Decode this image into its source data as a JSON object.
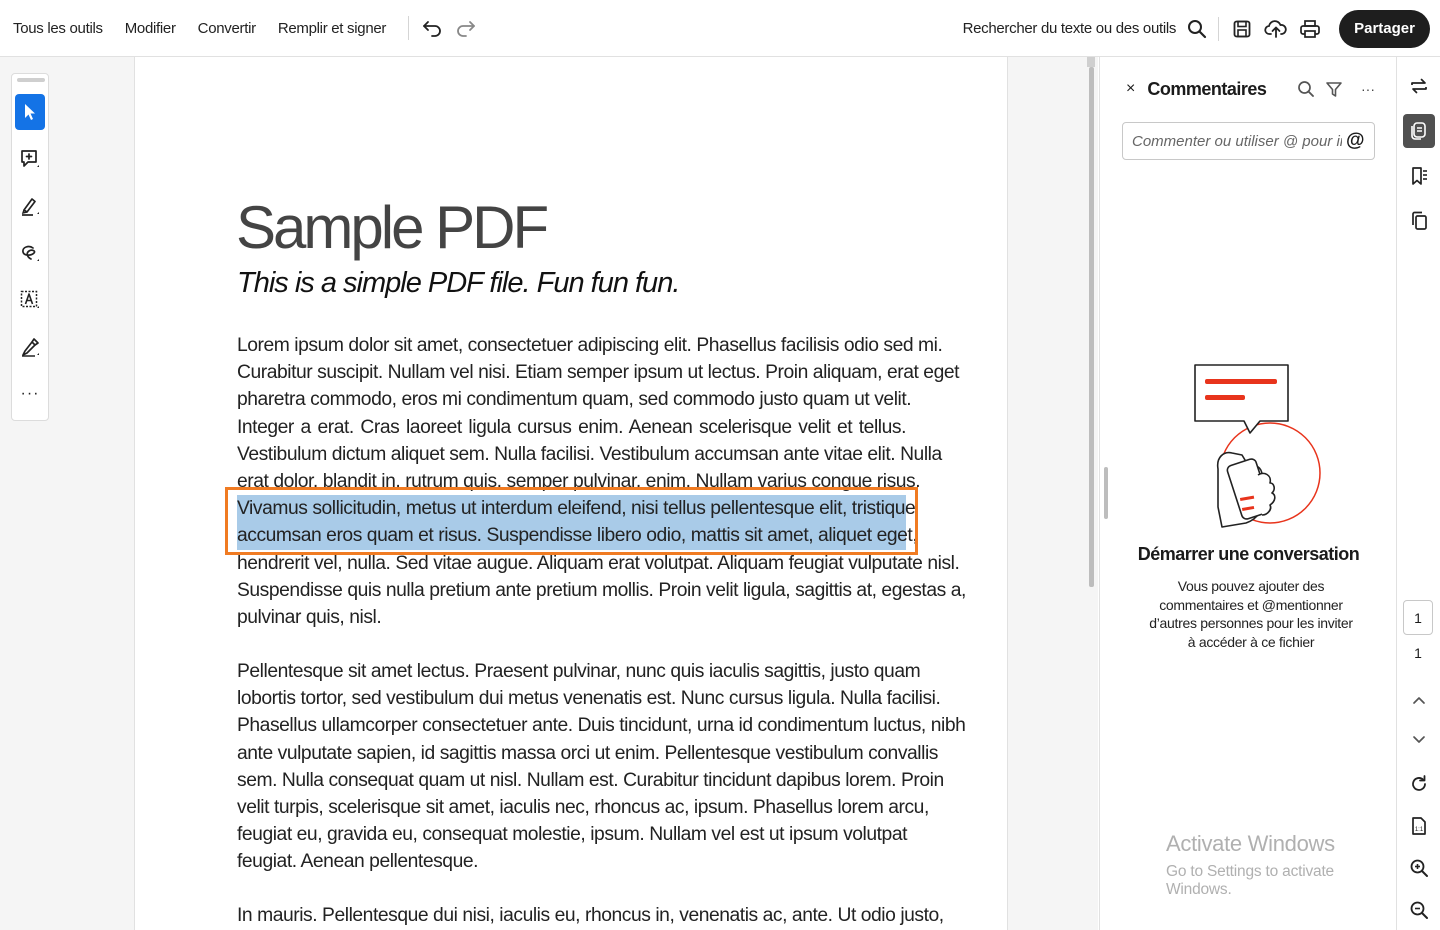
{
  "topbar": {
    "menu": [
      "Tous les outils",
      "Modifier",
      "Convertir",
      "Remplir et signer"
    ],
    "search_label": "Rechercher du texte ou des outils",
    "share_label": "Partager"
  },
  "tools": [
    "select-tool-icon",
    "add-comment-icon",
    "highlight-pen-icon",
    "lasso-draw-icon",
    "text-box-icon",
    "fill-sign-icon",
    "more-icon"
  ],
  "more_label": "···",
  "document": {
    "title": "Sample PDF",
    "subtitle": "This is a simple PDF file. Fun fun fun.",
    "paragraph1": {
      "before": [
        "Lorem ipsum dolor sit amet, consectetuer adipiscing elit. Phasellus facilisis odio sed mi.",
        "Curabitur suscipit. Nullam vel nisi. Etiam semper ipsum ut lectus. Proin aliquam, erat eget",
        "pharetra commodo, eros mi condimentum quam, sed commodo justo quam ut velit.",
        "Integer a erat. Cras laoreet ligula cursus enim. Aenean scelerisque velit et tellus.",
        "Vestibulum dictum aliquet sem. Nulla facilisi. Vestibulum accumsan ante vitae elit. Nulla",
        "erat dolor, blandit in, rutrum quis, semper pulvinar, enim. Nullam varius congue risus."
      ],
      "highlighted": [
        "Vivamus sollicitudin, metus ut interdum eleifend, nisi tellus pellentesque elit, tristique",
        "accumsan eros quam et risus. Suspendisse libero odio, mattis sit amet, aliquet eget,"
      ],
      "after": [
        "hendrerit vel, nulla. Sed vitae augue. Aliquam erat volutpat. Aliquam feugiat vulputate nisl.",
        "Suspendisse quis nulla pretium ante pretium mollis. Proin velit ligula, sagittis at, egestas a,",
        "pulvinar quis, nisl."
      ]
    },
    "paragraph2": [
      "Pellentesque sit amet lectus. Praesent pulvinar, nunc quis iaculis sagittis, justo quam",
      "lobortis tortor, sed vestibulum dui metus venenatis est. Nunc cursus ligula. Nulla facilisi.",
      "Phasellus ullamcorper consectetuer ante. Duis tincidunt, urna id condimentum luctus, nibh",
      "ante vulputate sapien, id sagittis massa orci ut enim. Pellentesque vestibulum convallis",
      "sem. Nulla consequat quam ut nisl. Nullam est. Curabitur tincidunt dapibus lorem. Proin",
      "velit turpis, scelerisque sit amet, iaculis nec, rhoncus ac, ipsum. Phasellus lorem arcu,",
      "feugiat eu, gravida eu, consequat molestie, ipsum. Nullam vel est ut ipsum volutpat",
      "feugiat. Aenean pellentesque."
    ],
    "paragraph3": [
      "In mauris. Pellentesque dui nisi, iaculis eu, rhoncus in, venenatis ac, ante. Ut odio justo,"
    ]
  },
  "comments": {
    "close": "×",
    "title": "Commentaires",
    "input_placeholder": "Commenter ou utiliser @ pour in...",
    "at_symbol": "@",
    "heading": "Démarrer une conversation",
    "description": "Vous pouvez ajouter des commentaires et @mentionner d’autres personnes pour les inviter à accéder à ce fichier",
    "more": "···"
  },
  "watermark": {
    "line1": "Activate Windows",
    "line2": "Go to Settings to activate Windows."
  },
  "page_nav": {
    "current": "1",
    "total": "1"
  },
  "colors": {
    "accent": "#1473e6",
    "selection_outline": "#f07b22",
    "highlight": "#a9cbe8",
    "share_bg": "#1e1e1e",
    "illustration_red": "#e8341c"
  }
}
